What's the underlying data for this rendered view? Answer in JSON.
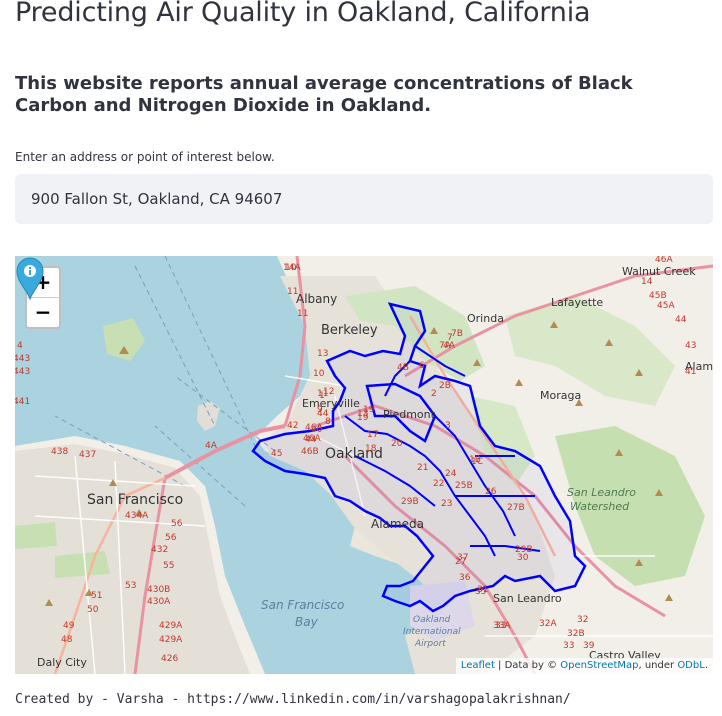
{
  "header": {
    "title": "Predicting Air Quality in Oakland, California",
    "subtitle": "This website reports annual average concentrations of Black Carbon and Nitrogen Dioxide in Oakland."
  },
  "search": {
    "label": "Enter an address or point of interest below.",
    "value": "900 Fallon St, Oakland, CA 94607"
  },
  "map": {
    "zoom_in_label": "+",
    "zoom_out_label": "−",
    "attribution": {
      "leaflet": "Leaflet",
      "sep1": " | Data by © ",
      "osm": "OpenStreetMap",
      "sep2": ", under ",
      "odbl": "ODbL",
      "end": "."
    },
    "boundary_color": "#0000ff",
    "marker_color": "#38aadd",
    "places": {
      "berkeley": "Berkeley",
      "albany": "Albany",
      "emeryville": "Emeryville",
      "piedmont": "Piedmont",
      "oakland": "Oakland",
      "alameda": "Alameda",
      "san_francisco": "San Francisco",
      "daly_city": "Daly City",
      "orinda": "Orinda",
      "lafayette": "Lafayette",
      "walnut_creek": "Walnut Creek",
      "moraga": "Moraga",
      "alamo": "Alamo",
      "san_leandro": "San Leandro",
      "castro_valley": "Castro Valley",
      "san_leandro_watershed_1": "San Leandro",
      "san_leandro_watershed_2": "Watershed",
      "sf_bay_1": "San Francisco",
      "sf_bay_2": "Bay",
      "airport_1": "Oakland",
      "airport_2": "International",
      "airport_3": "Airport"
    },
    "routes": [
      "4",
      "10",
      "14A",
      "11",
      "11",
      "4A",
      "443",
      "443",
      "441",
      "438",
      "437",
      "434A",
      "432",
      "430B",
      "430A",
      "429A",
      "429A",
      "426",
      "53",
      "55",
      "56",
      "56",
      "51",
      "50",
      "49",
      "48",
      "46A",
      "46B",
      "44",
      "42",
      "45",
      "46A",
      "44",
      "40",
      "1",
      "13",
      "17",
      "18",
      "19",
      "19",
      "4B",
      "4A",
      "6",
      "7",
      "7B",
      "7A",
      "2",
      "2B",
      "3",
      "1B",
      "1C",
      "24",
      "25B",
      "26",
      "27B",
      "27",
      "29B",
      "29B",
      "30",
      "31",
      "33",
      "33A",
      "36",
      "35",
      "37",
      "32",
      "32A",
      "32B",
      "33",
      "39",
      "14",
      "45B",
      "45A",
      "44",
      "43",
      "41",
      "46A",
      "13",
      "11",
      "10",
      "12",
      "9",
      "8",
      "20",
      "21",
      "22",
      "23"
    ]
  },
  "footer": {
    "credit": "Created by - Varsha - https://www.linkedin.com/in/varshagopalakrishnan/"
  }
}
